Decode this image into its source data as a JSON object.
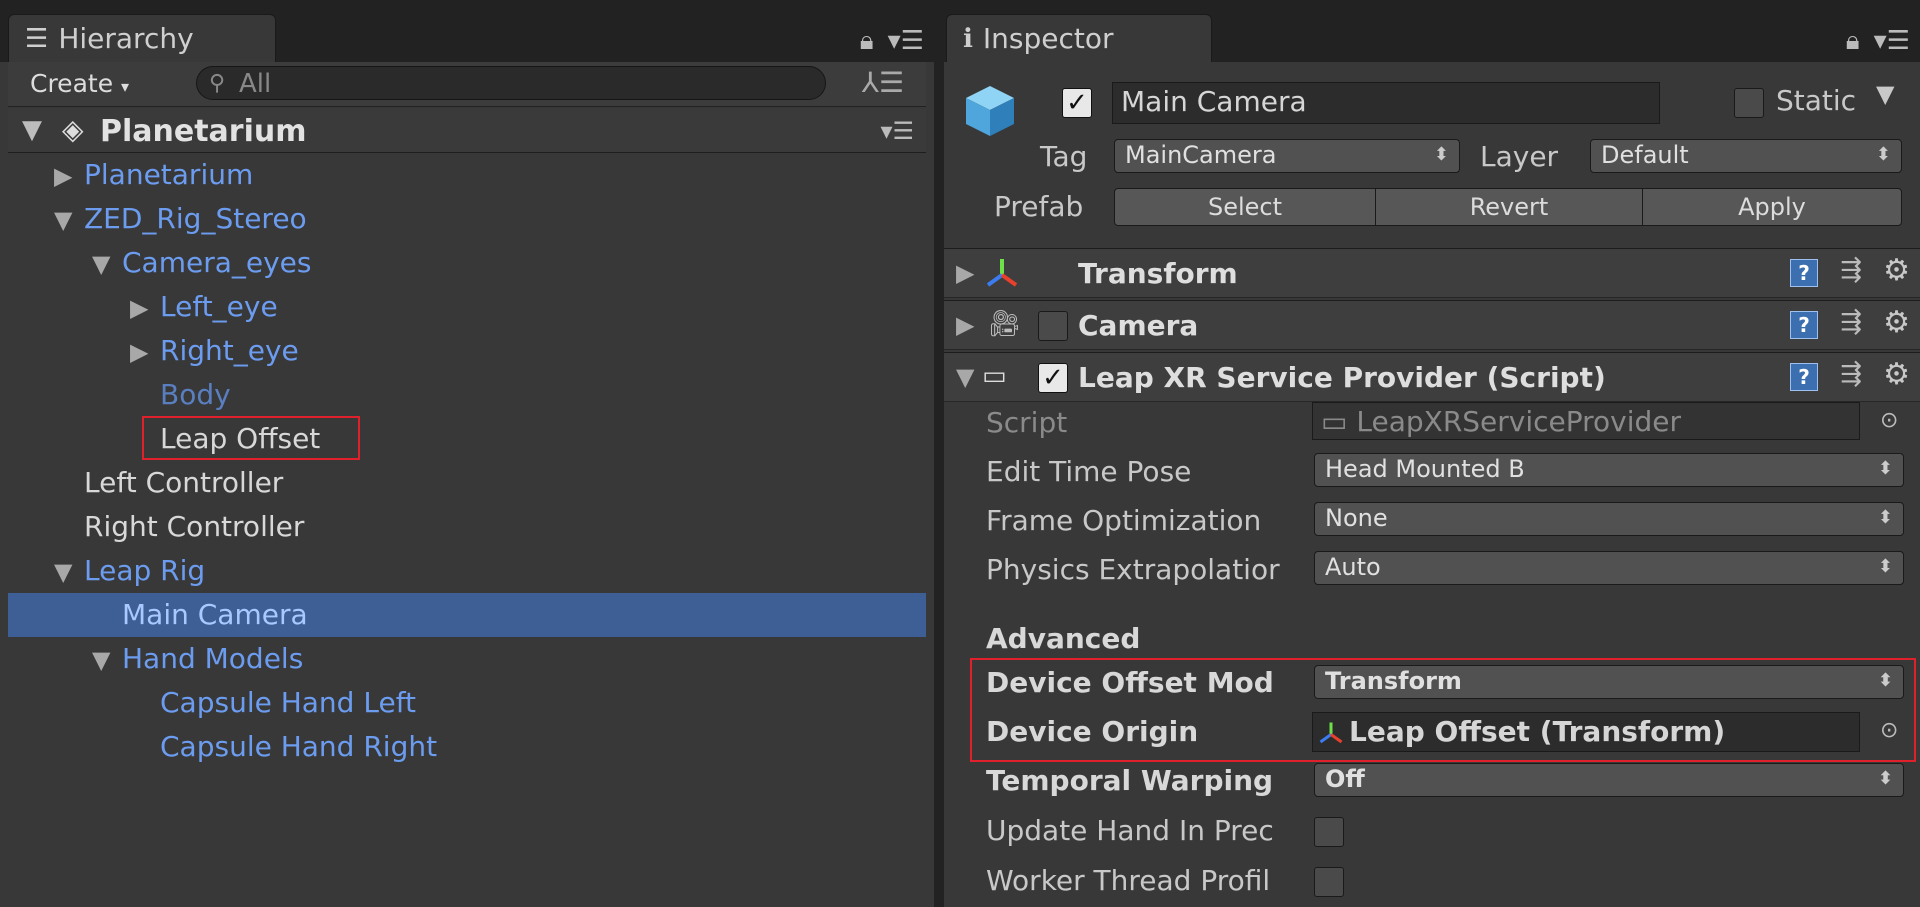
{
  "hierarchy": {
    "tab_label": "Hierarchy",
    "create_label": "Create",
    "search_placeholder": "All",
    "scene_name": "Planetarium",
    "rows": [
      {
        "label": "Planetarium",
        "depth": 0,
        "arrow": "▶",
        "color": "blue"
      },
      {
        "label": "ZED_Rig_Stereo",
        "depth": 0,
        "arrow": "▼",
        "color": "blue"
      },
      {
        "label": "Camera_eyes",
        "depth": 1,
        "arrow": "▼",
        "color": "blue"
      },
      {
        "label": "Left_eye",
        "depth": 2,
        "arrow": "▶",
        "color": "blue"
      },
      {
        "label": "Right_eye",
        "depth": 2,
        "arrow": "▶",
        "color": "blue"
      },
      {
        "label": "Body",
        "depth": 2,
        "arrow": "",
        "color": "blue-dim"
      },
      {
        "label": "Leap Offset",
        "depth": 2,
        "arrow": "",
        "color": "white"
      },
      {
        "label": "Left Controller",
        "depth": 0,
        "arrow": "",
        "color": "white"
      },
      {
        "label": "Right Controller",
        "depth": 0,
        "arrow": "",
        "color": "white"
      },
      {
        "label": "Leap Rig",
        "depth": 0,
        "arrow": "▼",
        "color": "blue"
      },
      {
        "label": "Main Camera",
        "depth": 1,
        "arrow": "",
        "color": "blue",
        "selected": true
      },
      {
        "label": "Hand Models",
        "depth": 1,
        "arrow": "▼",
        "color": "blue"
      },
      {
        "label": "Capsule Hand Left",
        "depth": 2,
        "arrow": "",
        "color": "blue"
      },
      {
        "label": "Capsule Hand Right",
        "depth": 2,
        "arrow": "",
        "color": "blue"
      }
    ]
  },
  "inspector": {
    "tab_label": "Inspector",
    "object_name": "Main Camera",
    "object_active": true,
    "static_label": "Static",
    "static_checked": false,
    "tag_label": "Tag",
    "tag_value": "MainCamera",
    "layer_label": "Layer",
    "layer_value": "Default",
    "prefab_label": "Prefab",
    "prefab_buttons": [
      "Select",
      "Revert",
      "Apply"
    ],
    "components": [
      {
        "title": "Transform"
      },
      {
        "title": "Camera",
        "enabled": false
      },
      {
        "title": "Leap XR Service Provider (Script)",
        "enabled": true
      }
    ],
    "fields": {
      "script_label": "Script",
      "script_value": "LeapXRServiceProvider",
      "edit_time_pose_label": "Edit Time Pose",
      "edit_time_pose_value": "Head Mounted B",
      "frame_opt_label": "Frame Optimization",
      "frame_opt_value": "None",
      "physics_label": "Physics Extrapolatior",
      "physics_value": "Auto",
      "advanced_label": "Advanced",
      "device_offset_label": "Device Offset Mod",
      "device_offset_value": "Transform",
      "device_origin_label": "Device Origin",
      "device_origin_value": "Leap Offset (Transform)",
      "temporal_label": "Temporal Warping",
      "temporal_value": "Off",
      "update_hand_label": "Update Hand In Prec",
      "update_hand_checked": false,
      "worker_thread_label": "Worker Thread Profil",
      "worker_thread_checked": false
    }
  },
  "colors": {
    "accent_selection": "#3e5f96",
    "highlight_box": "#e0202a",
    "link_blue": "#6c9cf0"
  }
}
